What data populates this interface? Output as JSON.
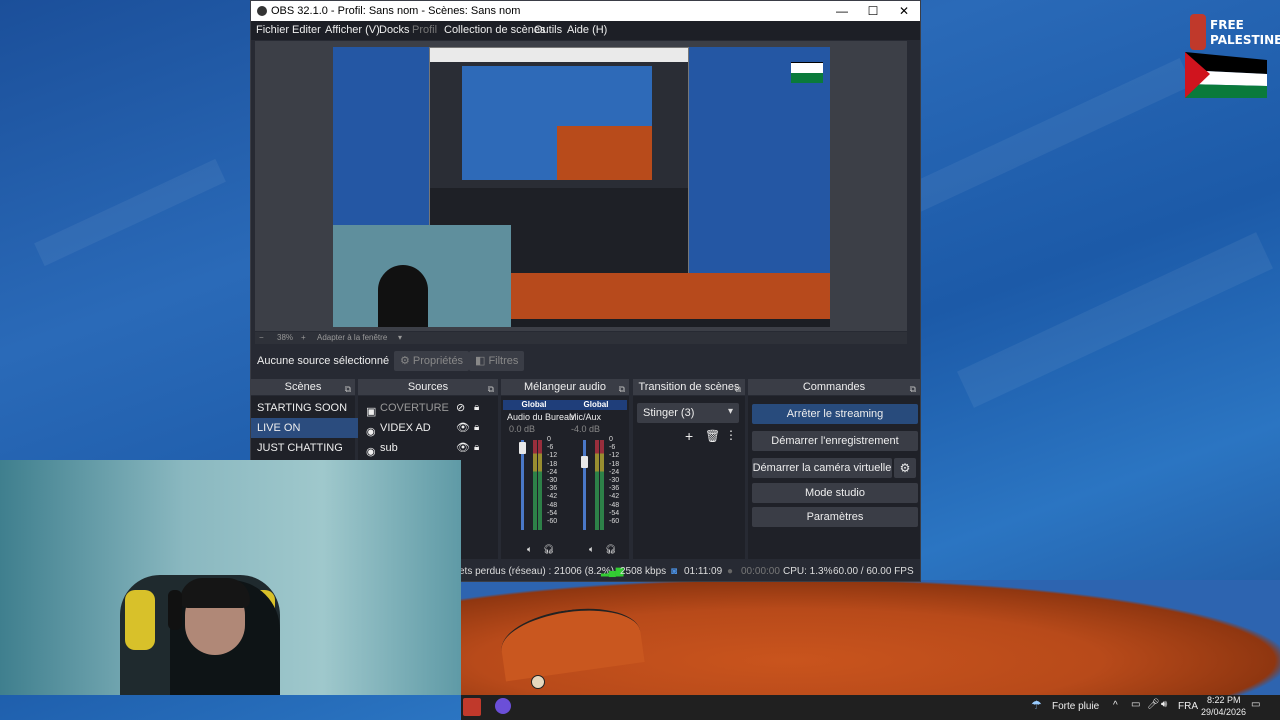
{
  "window": {
    "title": "OBS 32.1.0 - Profil: Sans nom - Scènes: Sans nom",
    "minimize": "—",
    "maximize": "☐",
    "close": "✕"
  },
  "menu": [
    "Fichier",
    "Editer",
    "Afficher (V)",
    "Docks",
    "Profil",
    "Collection de scènes",
    "Outils",
    "Aide (H)"
  ],
  "zoom": {
    "minus": "−",
    "value": "38%",
    "plus": "+",
    "fit": "Adapter à la fenêtre"
  },
  "properties_bar": {
    "no_source": "Aucune source sélectionné",
    "properties": "Propriétés",
    "filters": "Filtres"
  },
  "docks": {
    "scenes": {
      "title": "Scènes",
      "items": [
        {
          "label": "STARTING SOON",
          "active": false
        },
        {
          "label": "LIVE ON",
          "active": true
        },
        {
          "label": "JUST CHATTING",
          "active": false
        }
      ]
    },
    "sources": {
      "title": "Sources",
      "items": [
        {
          "label": "COVERTURE",
          "dim": true
        },
        {
          "label": "VIDEX AD",
          "dim": false
        },
        {
          "label": "sub",
          "dim": false
        }
      ]
    },
    "mixer": {
      "title": "Mélangeur audio",
      "channels": [
        {
          "head": "Global",
          "name": "Audio du Bureau",
          "db": "0.0 dB"
        },
        {
          "head": "Global",
          "name": "Mic/Aux",
          "db": "-4.0 dB"
        }
      ],
      "scale": [
        "0",
        "-6",
        "-12",
        "-18",
        "-24",
        "-30",
        "-36",
        "-42",
        "-48",
        "-54",
        "-60"
      ]
    },
    "transitions": {
      "title": "Transition de scènes",
      "selected": "Stinger (3)"
    },
    "commands": {
      "title": "Commandes",
      "buttons": [
        "Arrêter le streaming",
        "Démarrer l'enregistrement",
        "Démarrer la caméra virtuelle",
        "Mode studio",
        "Paramètres"
      ]
    }
  },
  "status": {
    "dropped": "ets perdus (réseau) : 21006 (8.2%)",
    "bitrate": "2508 kbps",
    "live_time": "01:11:09",
    "rec_time": "00:00:00",
    "cpu": "CPU: 1.3%",
    "fps": "60.00 / 60.00 FPS"
  },
  "desktop": {
    "logo_line1": "FREE",
    "logo_line2": "PALESTINE"
  },
  "taskbar": {
    "weather": "Forte pluie",
    "lang": "FRA",
    "time": "8:22 PM",
    "date": "29/04/2026"
  },
  "colors": {
    "accent": "#284b7c",
    "window_bg": "#272a33",
    "dock_bg": "#1f2128"
  }
}
